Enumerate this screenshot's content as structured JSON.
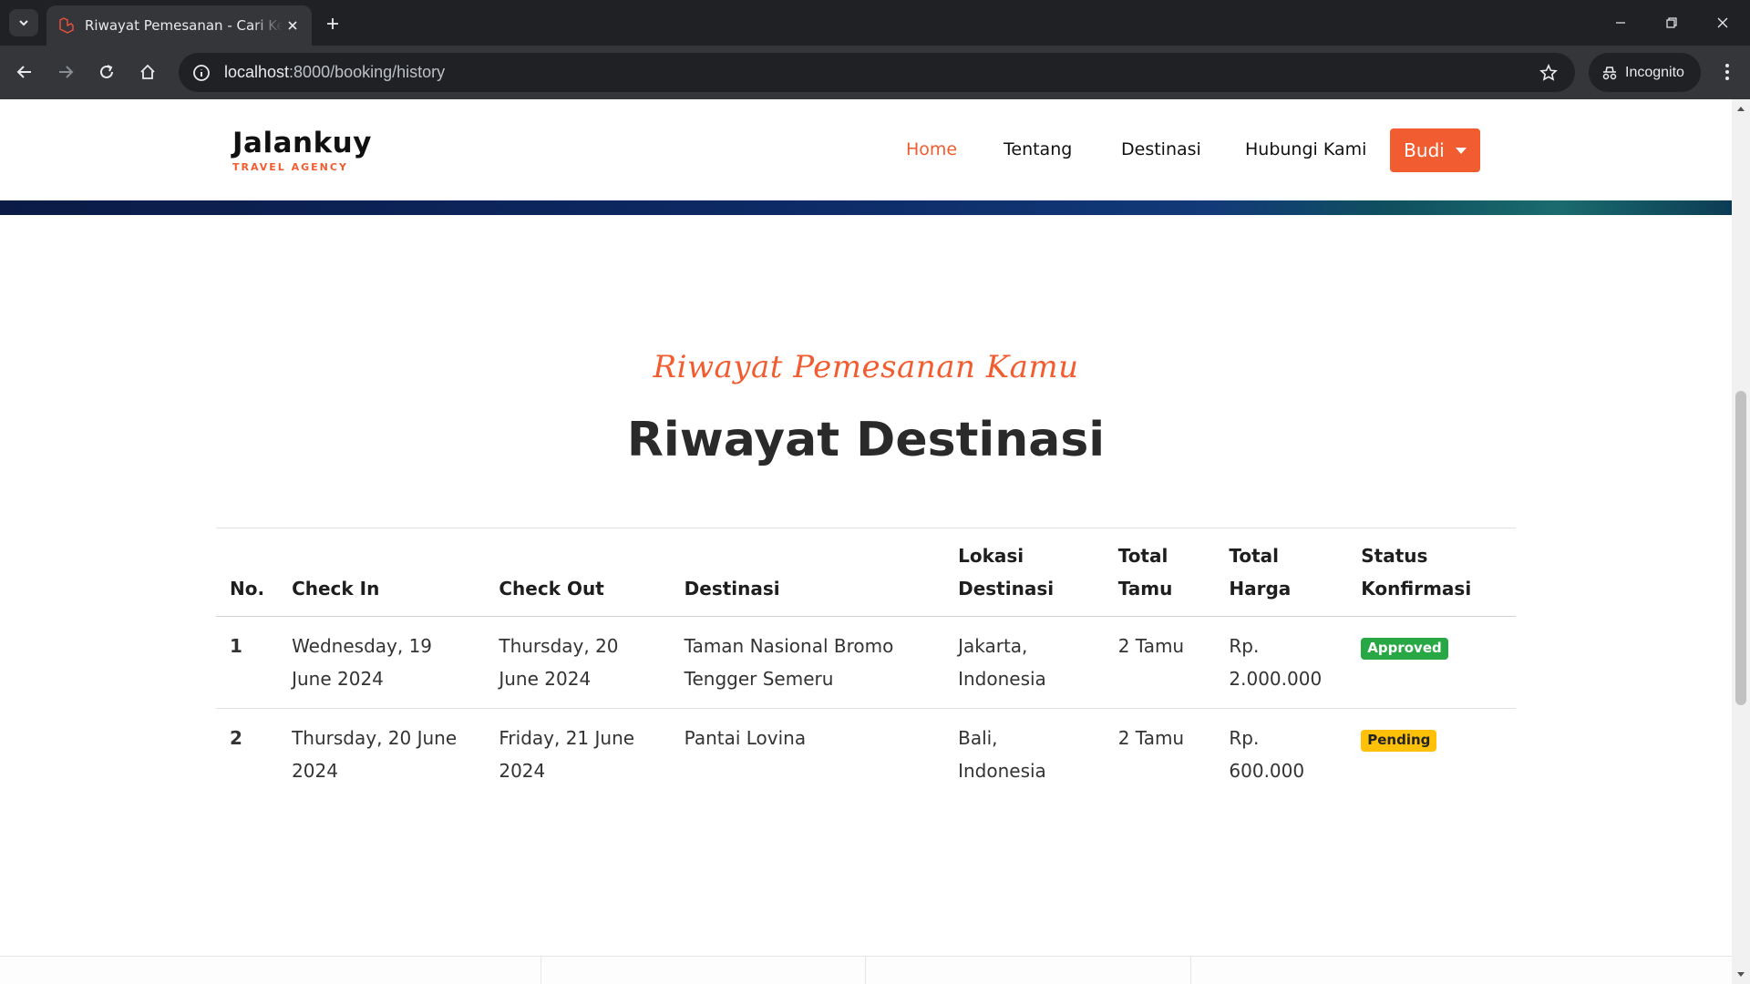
{
  "browser": {
    "tab_title": "Riwayat Pemesanan - Cari Kemu",
    "url_host": "localhost",
    "url_path": ":8000/booking/history",
    "profile_label": "Incognito",
    "icons": {
      "tab_menu": "chevron-down-icon",
      "tab_close": "close-icon",
      "new_tab": "plus-icon",
      "minimize": "minimize-icon",
      "restore": "restore-icon",
      "close_window": "close-icon",
      "back": "arrow-left-icon",
      "forward": "arrow-right-icon",
      "reload": "reload-icon",
      "home": "home-icon",
      "site_info": "info-icon",
      "bookmark": "star-icon",
      "incognito": "incognito-icon",
      "menu": "kebab-icon"
    }
  },
  "site": {
    "brand_name": "Jalankuy",
    "brand_tagline": "TRAVEL AGENCY",
    "accent_color": "#f15d30",
    "nav": {
      "home": "Home",
      "about": "Tentang",
      "destinations": "Destinasi",
      "contact": "Hubungi Kami"
    },
    "user_button": "Budi"
  },
  "section": {
    "subtitle": "Riwayat Pemesanan Kamu",
    "title": "Riwayat Destinasi"
  },
  "table": {
    "headers": {
      "no": "No.",
      "check_in": "Check In",
      "check_out": "Check Out",
      "destination": "Destinasi",
      "location": "Lokasi Destinasi",
      "guests": "Total Tamu",
      "price": "Total Harga",
      "status": "Status Konfirmasi"
    },
    "rows": [
      {
        "no": "1",
        "check_in": "Wednesday, 19 June 2024",
        "check_out": "Thursday, 20 June 2024",
        "destination": "Taman Nasional Bromo Tengger Semeru",
        "location": "Jakarta, Indonesia",
        "guests": "2 Tamu",
        "price": "Rp. 2.000.000",
        "status": "Approved",
        "status_color": "#28a745"
      },
      {
        "no": "2",
        "check_in": "Thursday, 20 June 2024",
        "check_out": "Friday, 21 June 2024",
        "destination": "Pantai Lovina",
        "location": "Bali, Indonesia",
        "guests": "2 Tamu",
        "price": "Rp. 600.000",
        "status": "Pending",
        "status_color": "#ffc107"
      }
    ]
  }
}
